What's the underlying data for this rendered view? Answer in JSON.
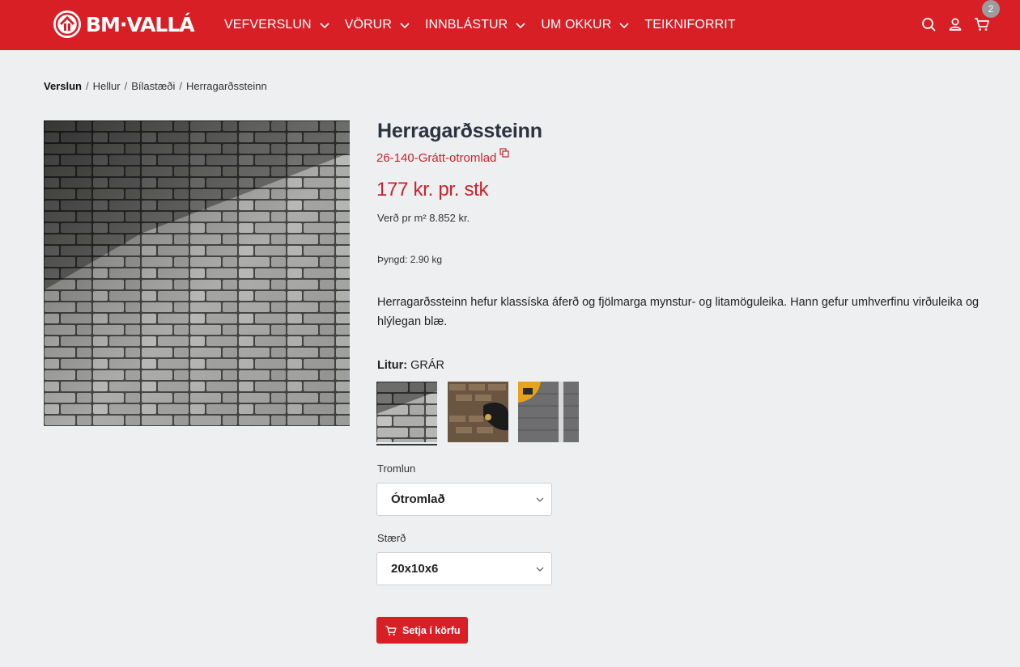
{
  "brand": {
    "name": "BM·VALLÁ",
    "accent": "#d91f26",
    "price_color": "#c8242b"
  },
  "nav": {
    "items": [
      {
        "label": "VEFVERSLUN",
        "has_dropdown": true
      },
      {
        "label": "VÖRUR",
        "has_dropdown": true
      },
      {
        "label": "INNBLÁSTUR",
        "has_dropdown": true
      },
      {
        "label": "UM OKKUR",
        "has_dropdown": true
      },
      {
        "label": "TEIKNIFORRIT",
        "has_dropdown": false
      }
    ],
    "icons": [
      "search-icon",
      "user-icon",
      "cart-icon"
    ],
    "cart_count": "2"
  },
  "breadcrumb": [
    "Verslun",
    "Hellur",
    "Bílastæði",
    "Herragarðssteinn"
  ],
  "product": {
    "title": "Herragarðssteinn",
    "sku": "26-140-Grátt-otromlad",
    "price": "177 kr. pr. stk",
    "price_per_m2": "Verð pr m² 8.852 kr.",
    "weight": "Þyngd: 2.90 kg",
    "description": "Herragarðssteinn hefur klassíska áferð og fjölmarga mynstur- og litamöguleika. Hann gefur umhverfinu virðuleika og hlýlegan blæ.",
    "color_label": "Litur:",
    "color_value": "GRÁR",
    "tromlun_label": "Tromlun",
    "tromlun_value": "Ótromlað",
    "size_label": "Stærð",
    "size_value": "20x10x6",
    "add_to_cart": "Setja í körfu"
  }
}
